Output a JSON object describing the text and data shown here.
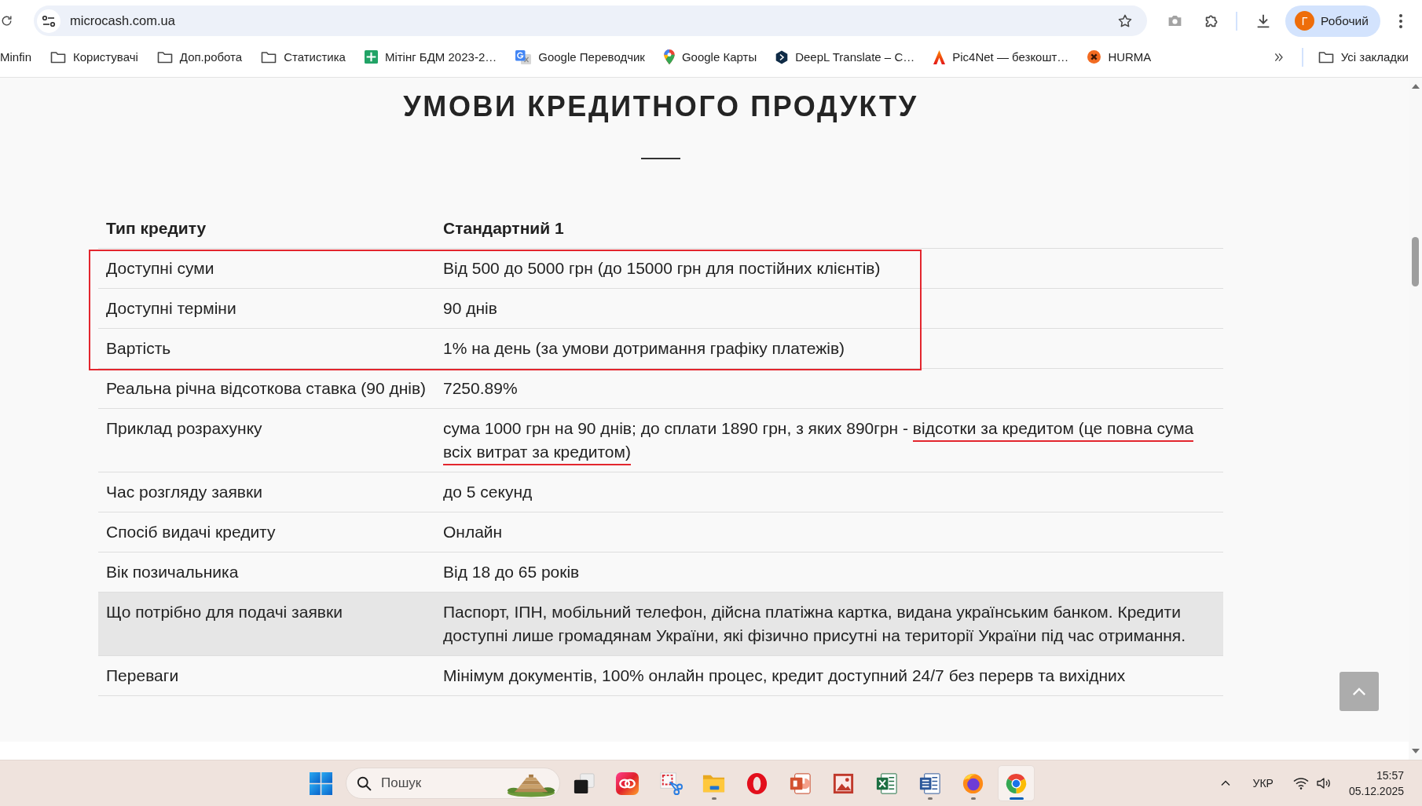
{
  "browser": {
    "url": "microcash.com.ua",
    "profile": {
      "initial": "Г",
      "name": "Робочий"
    }
  },
  "bookmarks": {
    "items": [
      {
        "kind": "link",
        "label": "Minfin"
      },
      {
        "kind": "folder",
        "label": "Користувачі"
      },
      {
        "kind": "folder",
        "label": "Доп.робота"
      },
      {
        "kind": "folder",
        "label": "Статистика"
      },
      {
        "kind": "link",
        "label": "Мітінг БДМ 2023-2…"
      },
      {
        "kind": "link",
        "label": "Google Переводчик"
      },
      {
        "kind": "link",
        "label": "Google Карты"
      },
      {
        "kind": "link",
        "label": "DeepL Translate – C…"
      },
      {
        "kind": "link",
        "label": "Pic4Net — безкошт…"
      },
      {
        "kind": "link",
        "label": "HURMA"
      }
    ],
    "all_bookmarks": "Усі закладки"
  },
  "page": {
    "title": "УМОВИ КРЕДИТНОГО ПРОДУКТУ",
    "table": {
      "columns": [
        "Тип кредиту",
        "Стандартний 1"
      ],
      "rows": [
        {
          "label": "Доступні суми",
          "value": "Від 500 до 5000 грн (до 15000 грн для постійних клієнтів)",
          "marked": true,
          "highlighted": false
        },
        {
          "label": "Доступні терміни",
          "value": "90 днів",
          "marked": true,
          "highlighted": false
        },
        {
          "label": "Вартість",
          "value": "1% на день (за умови дотримання графіку платежів)",
          "marked": true,
          "highlighted": false
        },
        {
          "label": "Реальна річна відсоткова ставка (90 днів)",
          "value": "7250.89%",
          "marked": false,
          "highlighted": false
        },
        {
          "label": "Приклад розрахунку",
          "value": [
            {
              "text": "сума 1000 грн на 90 днів; до сплати 1890 грн, з яких 890грн - ",
              "underlined": false
            },
            {
              "text": "відсотки за кредитом (це повна сума всіх витрат за кредитом)",
              "underlined": true
            }
          ],
          "marked": false,
          "highlighted": false
        },
        {
          "label": "Час розгляду заявки",
          "value": "до 5 секунд",
          "marked": false,
          "highlighted": false
        },
        {
          "label": "Спосіб видачі кредиту",
          "value": "Онлайн",
          "marked": false,
          "highlighted": false
        },
        {
          "label": "Вік позичальника",
          "value": "Від 18 до 65 років",
          "marked": false,
          "highlighted": false
        },
        {
          "label": "Що потрібно для подачі заявки",
          "value": "Паспорт, ІПН, мобільний телефон, дійсна платіжна картка, видана українським банком. Кредити доступні лише громадянам України, які фізично присутні на території України під час отримання.",
          "marked": false,
          "highlighted": true
        },
        {
          "label": "Переваги",
          "value": "Мінімум документів, 100% онлайн процес, кредит доступний 24/7 без перерв та вихідних",
          "marked": false,
          "highlighted": false
        }
      ]
    }
  },
  "taskbar": {
    "search": {
      "placeholder": "Пошук"
    },
    "apps": [
      {
        "running": false,
        "selected": false
      },
      {
        "running": false,
        "selected": false
      },
      {
        "running": false,
        "selected": false
      },
      {
        "running": true,
        "selected": false
      },
      {
        "running": false,
        "selected": false
      },
      {
        "running": false,
        "selected": false
      },
      {
        "running": false,
        "selected": false
      },
      {
        "running": false,
        "selected": false
      },
      {
        "running": true,
        "selected": false
      },
      {
        "running": true,
        "selected": false
      },
      {
        "running": true,
        "selected": true
      }
    ],
    "language": "УКР",
    "time": "15:57",
    "date": "05.12.2025"
  }
}
